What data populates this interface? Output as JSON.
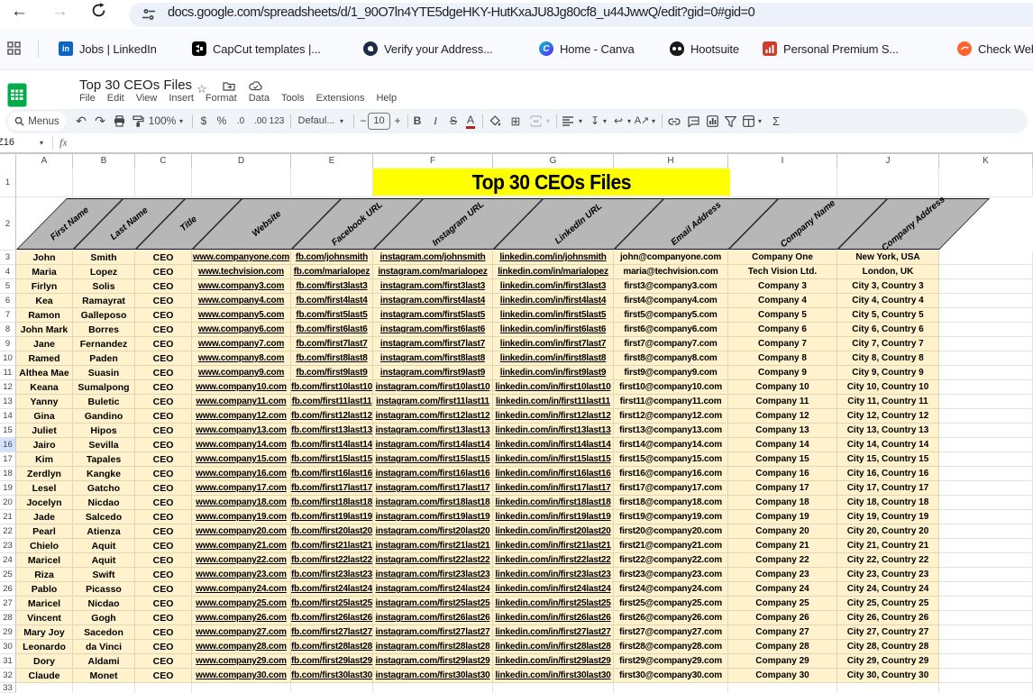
{
  "browser": {
    "url": "docs.google.com/spreadsheets/d/1_90O7ln4YTE5dgeHKY-HutKxaJU8Jg80cf8_u44JwwQ/edit?gid=0#gid=0",
    "bookmarks": [
      {
        "label": "Jobs | LinkedIn",
        "icon": "linkedin"
      },
      {
        "label": "CapCut templates |...",
        "icon": "capcut"
      },
      {
        "label": "Verify your Address...",
        "icon": "verify"
      },
      {
        "label": "Home - Canva",
        "icon": "canva"
      },
      {
        "label": "Hootsuite",
        "icon": "hootsuite"
      },
      {
        "label": "Personal Premium S...",
        "icon": "redbars"
      },
      {
        "label": "Check Webs...",
        "icon": "orangeball"
      }
    ]
  },
  "sheets": {
    "doc_title": "Top 30 CEOs Files",
    "menus": [
      "File",
      "Edit",
      "View",
      "Insert",
      "Format",
      "Data",
      "Tools",
      "Extensions",
      "Help"
    ],
    "toolbar": {
      "menus_label": "Menus",
      "zoom": "100%",
      "currency": "$",
      "percent": "%",
      "dec_dec": ".0",
      "inc_dec": ".00",
      "more_formats": "123",
      "font_name": "Defaul...",
      "minus": "−",
      "font_size": "10",
      "plus": "+",
      "bold": "B",
      "italic": "I",
      "strike": "S",
      "text_color": "A",
      "functions": "Σ"
    },
    "name_box": "Z16",
    "fx": "fx"
  },
  "grid": {
    "column_letters": [
      "A",
      "B",
      "C",
      "D",
      "E",
      "F",
      "G",
      "H",
      "I",
      "J",
      "K"
    ],
    "banner_title": "Top 30 CEOs Files",
    "headers": [
      "First Name",
      "Last Name",
      "Title",
      "Website",
      "Facebook URL",
      "Instagram URL",
      "LinkedIn URL",
      "Email Address",
      "Company Name",
      "Company Address"
    ],
    "row1_number": "1",
    "row2_number": "2",
    "row33_number": "33",
    "selected_row": 16,
    "colors": {
      "cell_fill": "#fff2cc",
      "banner_yellow": "#ffff00",
      "header_gray": "#b7b7b7",
      "selected_row_fill": "#d3e3fd",
      "grid_line_cream": "#e1d6b5",
      "grid_line": "#e1e3e1",
      "sheets_green": "#00ac47"
    },
    "rows": [
      {
        "n": 3,
        "c": [
          "John",
          "Smith",
          "CEO",
          "www.companyone.com",
          "fb.com/johnsmith",
          "instagram.com/johnsmith",
          "linkedin.com/in/johnsmith",
          "john@companyone.com",
          "Company One",
          "New York, USA"
        ]
      },
      {
        "n": 4,
        "c": [
          "Maria",
          "Lopez",
          "CEO",
          "www.techvision.com",
          "fb.com/marialopez",
          "instagram.com/marialopez",
          "linkedin.com/in/marialopez",
          "maria@techvision.com",
          "Tech Vision Ltd.",
          "London, UK"
        ]
      },
      {
        "n": 5,
        "c": [
          "Firlyn",
          "Solis",
          "CEO",
          "www.company3.com",
          "fb.com/first3last3",
          "instagram.com/first3last3",
          "linkedin.com/in/first3last3",
          "first3@company3.com",
          "Company 3",
          "City 3, Country 3"
        ]
      },
      {
        "n": 6,
        "c": [
          "Kea",
          "Ramayrat",
          "CEO",
          "www.company4.com",
          "fb.com/first4last4",
          "instagram.com/first4last4",
          "linkedin.com/in/first4last4",
          "first4@company4.com",
          "Company 4",
          "City 4, Country 4"
        ]
      },
      {
        "n": 7,
        "c": [
          "Ramon",
          "Galleposo",
          "CEO",
          "www.company5.com",
          "fb.com/first5last5",
          "instagram.com/first5last5",
          "linkedin.com/in/first5last5",
          "first5@company5.com",
          "Company 5",
          "City 5, Country 5"
        ]
      },
      {
        "n": 8,
        "c": [
          "John Mark",
          "Borres",
          "CEO",
          "www.company6.com",
          "fb.com/first6last6",
          "instagram.com/first6last6",
          "linkedin.com/in/first6last6",
          "first6@company6.com",
          "Company 6",
          "City 6, Country 6"
        ]
      },
      {
        "n": 9,
        "c": [
          "Jane",
          "Fernandez",
          "CEO",
          "www.company7.com",
          "fb.com/first7last7",
          "instagram.com/first7last7",
          "linkedin.com/in/first7last7",
          "first7@company7.com",
          "Company 7",
          "City 7, Country 7"
        ]
      },
      {
        "n": 10,
        "c": [
          "Ramed",
          "Paden",
          "CEO",
          "www.company8.com",
          "fb.com/first8last8",
          "instagram.com/first8last8",
          "linkedin.com/in/first8last8",
          "first8@company8.com",
          "Company 8",
          "City 8, Country 8"
        ]
      },
      {
        "n": 11,
        "c": [
          "Althea Mae",
          "Suasin",
          "CEO",
          "www.company9.com",
          "fb.com/first9last9",
          "instagram.com/first9last9",
          "linkedin.com/in/first9last9",
          "first9@company9.com",
          "Company 9",
          "City 9, Country 9"
        ]
      },
      {
        "n": 12,
        "c": [
          "Keana",
          "Sumalpong",
          "CEO",
          "www.company10.com",
          "fb.com/first10last10",
          "instagram.com/first10last10",
          "linkedin.com/in/first10last10",
          "first10@company10.com",
          "Company 10",
          "City 10, Country 10"
        ]
      },
      {
        "n": 13,
        "c": [
          "Yanny",
          "Buletic",
          "CEO",
          "www.company11.com",
          "fb.com/first11last11",
          "instagram.com/first11last11",
          "linkedin.com/in/first11last11",
          "first11@company11.com",
          "Company 11",
          "City 11, Country 11"
        ]
      },
      {
        "n": 14,
        "c": [
          "Gina",
          "Gandino",
          "CEO",
          "www.company12.com",
          "fb.com/first12last12",
          "instagram.com/first12last12",
          "linkedin.com/in/first12last12",
          "first12@company12.com",
          "Company 12",
          "City 12, Country 12"
        ]
      },
      {
        "n": 15,
        "c": [
          "Juliet",
          "Hipos",
          "CEO",
          "www.company13.com",
          "fb.com/first13last13",
          "instagram.com/first13last13",
          "linkedin.com/in/first13last13",
          "first13@company13.com",
          "Company 13",
          "City 13, Country 13"
        ]
      },
      {
        "n": 16,
        "c": [
          "Jairo",
          "Sevilla",
          "CEO",
          "www.company14.com",
          "fb.com/first14last14",
          "instagram.com/first14last14",
          "linkedin.com/in/first14last14",
          "first14@company14.com",
          "Company 14",
          "City 14, Country 14"
        ]
      },
      {
        "n": 17,
        "c": [
          "Kim",
          "Tapales",
          "CEO",
          "www.company15.com",
          "fb.com/first15last15",
          "instagram.com/first15last15",
          "linkedin.com/in/first15last15",
          "first15@company15.com",
          "Company 15",
          "City 15, Country 15"
        ]
      },
      {
        "n": 18,
        "c": [
          "Zerdlyn",
          "Kangke",
          "CEO",
          "www.company16.com",
          "fb.com/first16last16",
          "instagram.com/first16last16",
          "linkedin.com/in/first16last16",
          "first16@company16.com",
          "Company 16",
          "City 16, Country 16"
        ]
      },
      {
        "n": 19,
        "c": [
          "Lesel",
          "Gatcho",
          "CEO",
          "www.company17.com",
          "fb.com/first17last17",
          "instagram.com/first17last17",
          "linkedin.com/in/first17last17",
          "first17@company17.com",
          "Company 17",
          "City 17, Country 17"
        ]
      },
      {
        "n": 20,
        "c": [
          "Jocelyn",
          "Nicdao",
          "CEO",
          "www.company18.com",
          "fb.com/first18last18",
          "instagram.com/first18last18",
          "linkedin.com/in/first18last18",
          "first18@company18.com",
          "Company 18",
          "City 18, Country 18"
        ]
      },
      {
        "n": 21,
        "c": [
          "Jade",
          "Salcedo",
          "CEO",
          "www.company19.com",
          "fb.com/first19last19",
          "instagram.com/first19last19",
          "linkedin.com/in/first19last19",
          "first19@company19.com",
          "Company 19",
          "City 19, Country 19"
        ]
      },
      {
        "n": 22,
        "c": [
          "Pearl",
          "Atienza",
          "CEO",
          "www.company20.com",
          "fb.com/first20last20",
          "instagram.com/first20last20",
          "linkedin.com/in/first20last20",
          "first20@company20.com",
          "Company 20",
          "City 20, Country 20"
        ]
      },
      {
        "n": 23,
        "c": [
          "Chielo",
          "Aquit",
          "CEO",
          "www.company21.com",
          "fb.com/first21last21",
          "instagram.com/first21last21",
          "linkedin.com/in/first21last21",
          "first21@company21.com",
          "Company 21",
          "City 21, Country 21"
        ]
      },
      {
        "n": 24,
        "c": [
          "Maricel",
          "Aquit",
          "CEO",
          "www.company22.com",
          "fb.com/first22last22",
          "instagram.com/first22last22",
          "linkedin.com/in/first22last22",
          "first22@company22.com",
          "Company 22",
          "City 22, Country 22"
        ]
      },
      {
        "n": 25,
        "c": [
          "Riza",
          "Swift",
          "CEO",
          "www.company23.com",
          "fb.com/first23last23",
          "instagram.com/first23last23",
          "linkedin.com/in/first23last23",
          "first23@company23.com",
          "Company 23",
          "City 23, Country 23"
        ]
      },
      {
        "n": 26,
        "c": [
          "Pablo",
          "Picasso",
          "CEO",
          "www.company24.com",
          "fb.com/first24last24",
          "instagram.com/first24last24",
          "linkedin.com/in/first24last24",
          "first24@company24.com",
          "Company 24",
          "City 24, Country 24"
        ]
      },
      {
        "n": 27,
        "c": [
          "Maricel",
          "Nicdao",
          "CEO",
          "www.company25.com",
          "fb.com/first25last25",
          "instagram.com/first25last25",
          "linkedin.com/in/first25last25",
          "first25@company25.com",
          "Company 25",
          "City 25, Country 25"
        ]
      },
      {
        "n": 28,
        "c": [
          "Vincent",
          "Gogh",
          "CEO",
          "www.company26.com",
          "fb.com/first26last26",
          "instagram.com/first26last26",
          "linkedin.com/in/first26last26",
          "first26@company26.com",
          "Company 26",
          "City 26, Country 26"
        ]
      },
      {
        "n": 29,
        "c": [
          "Mary Joy",
          "Sacedon",
          "CEO",
          "www.company27.com",
          "fb.com/first27last27",
          "instagram.com/first27last27",
          "linkedin.com/in/first27last27",
          "first27@company27.com",
          "Company 27",
          "City 27, Country 27"
        ]
      },
      {
        "n": 30,
        "c": [
          "Leonardo",
          "da Vinci",
          "CEO",
          "www.company28.com",
          "fb.com/first28last28",
          "instagram.com/first28last28",
          "linkedin.com/in/first28last28",
          "first28@company28.com",
          "Company 28",
          "City 28, Country 28"
        ]
      },
      {
        "n": 31,
        "c": [
          "Dory",
          "Aldami",
          "CEO",
          "www.company29.com",
          "fb.com/first29last29",
          "instagram.com/first29last29",
          "linkedin.com/in/first29last29",
          "first29@company29.com",
          "Company 29",
          "City 29, Country 29"
        ]
      },
      {
        "n": 32,
        "c": [
          "Claude",
          "Monet",
          "CEO",
          "www.company30.com",
          "fb.com/first30last30",
          "instagram.com/first30last30",
          "linkedin.com/in/first30last30",
          "first30@company30.com",
          "Company 30",
          "City 30, Country 30"
        ]
      }
    ]
  }
}
